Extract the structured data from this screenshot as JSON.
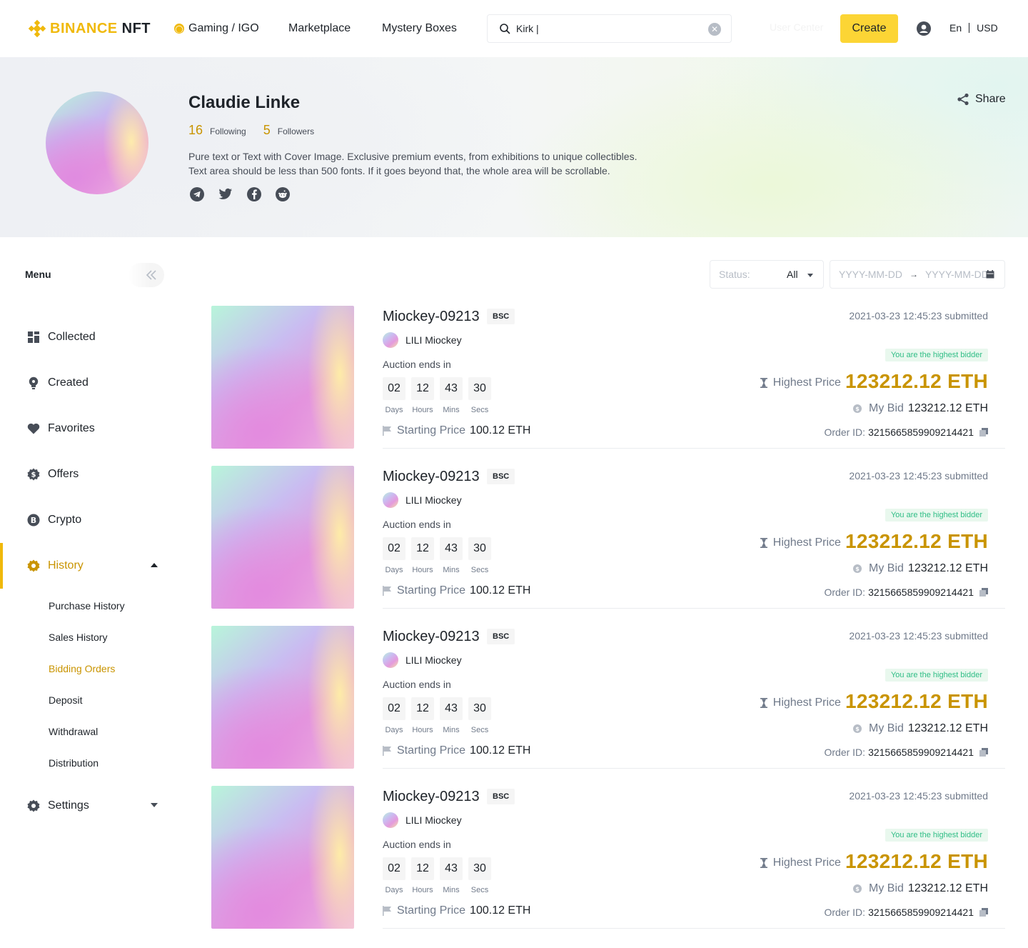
{
  "header": {
    "logo_brand": "BINANCE",
    "logo_product": "NFT",
    "nav": [
      {
        "label": "Gaming / IGO"
      },
      {
        "label": "Marketplace"
      },
      {
        "label": "Mystery Boxes"
      }
    ],
    "search": {
      "value": "Kirk |",
      "icon": "search-icon"
    },
    "user_center_label": "User Center",
    "create_label": "Create",
    "language": "En",
    "currency": "USD"
  },
  "profile": {
    "name": "Claudie Linke",
    "following_count": "16",
    "following_label": "Following",
    "followers_count": "5",
    "followers_label": "Followers",
    "bio_line1": "Pure text or Text with Cover Image. Exclusive premium events, from exhibitions to unique collectibles.",
    "bio_line2": "Text area should be less than 500 fonts. If it goes beyond that, the whole area will be scrollable.",
    "socials": [
      "telegram-icon",
      "twitter-icon",
      "facebook-icon",
      "reddit-icon"
    ],
    "share_label": "Share"
  },
  "sidebar": {
    "title": "Menu",
    "items": [
      {
        "label": "Collected",
        "icon": "grid-icon"
      },
      {
        "label": "Created",
        "icon": "bulb-icon"
      },
      {
        "label": "Favorites",
        "icon": "heart-icon"
      },
      {
        "label": "Offers",
        "icon": "dollar-icon"
      },
      {
        "label": "Crypto",
        "icon": "bitcoin-icon"
      },
      {
        "label": "History",
        "icon": "gear-icon",
        "active": true
      },
      {
        "label": "Settings",
        "icon": "settings-icon"
      }
    ],
    "history_sub": [
      {
        "label": "Purchase History"
      },
      {
        "label": "Sales History"
      },
      {
        "label": "Bidding Orders",
        "active": true
      },
      {
        "label": "Deposit"
      },
      {
        "label": "Withdrawal"
      },
      {
        "label": "Distribution"
      }
    ]
  },
  "filters": {
    "status_label": "Status:",
    "status_value": "All",
    "date_start_placeholder": "YYYY-MM-DD",
    "date_end_placeholder": "YYYY-MM-DD"
  },
  "orders": [
    {
      "title": "Miockey-09213",
      "chain": "BSC",
      "creator": "LILI Miockey",
      "auction_label": "Auction ends in",
      "countdown": [
        {
          "v": "02",
          "u": "Days"
        },
        {
          "v": "12",
          "u": "Hours"
        },
        {
          "v": "43",
          "u": "Mins"
        },
        {
          "v": "30",
          "u": "Secs"
        }
      ],
      "starting_label": "Starting Price",
      "starting_price": "100.12 ETH",
      "submitted": "2021-03-23 12:45:23 submitted",
      "bidder_badge": "You are the highest bidder",
      "highest_label": "Highest Price",
      "highest_price": "123212.12 ETH",
      "mybid_label": "My Bid",
      "mybid": "123212.12 ETH",
      "order_label": "Order ID:",
      "order_id": "3215665859909214421"
    },
    {
      "title": "Miockey-09213",
      "chain": "BSC",
      "creator": "LILI Miockey",
      "auction_label": "Auction ends in",
      "countdown": [
        {
          "v": "02",
          "u": "Days"
        },
        {
          "v": "12",
          "u": "Hours"
        },
        {
          "v": "43",
          "u": "Mins"
        },
        {
          "v": "30",
          "u": "Secs"
        }
      ],
      "starting_label": "Starting Price",
      "starting_price": "100.12 ETH",
      "submitted": "2021-03-23 12:45:23 submitted",
      "bidder_badge": "You are the highest bidder",
      "highest_label": "Highest Price",
      "highest_price": "123212.12 ETH",
      "mybid_label": "My Bid",
      "mybid": "123212.12 ETH",
      "order_label": "Order ID:",
      "order_id": "3215665859909214421"
    },
    {
      "title": "Miockey-09213",
      "chain": "BSC",
      "creator": "LILI Miockey",
      "auction_label": "Auction ends in",
      "countdown": [
        {
          "v": "02",
          "u": "Days"
        },
        {
          "v": "12",
          "u": "Hours"
        },
        {
          "v": "43",
          "u": "Mins"
        },
        {
          "v": "30",
          "u": "Secs"
        }
      ],
      "starting_label": "Starting Price",
      "starting_price": "100.12 ETH",
      "submitted": "2021-03-23 12:45:23 submitted",
      "bidder_badge": "You are the highest bidder",
      "highest_label": "Highest Price",
      "highest_price": "123212.12 ETH",
      "mybid_label": "My Bid",
      "mybid": "123212.12 ETH",
      "order_label": "Order ID:",
      "order_id": "3215665859909214421"
    },
    {
      "title": "Miockey-09213",
      "chain": "BSC",
      "creator": "LILI Miockey",
      "auction_label": "Auction ends in",
      "countdown": [
        {
          "v": "02",
          "u": "Days"
        },
        {
          "v": "12",
          "u": "Hours"
        },
        {
          "v": "43",
          "u": "Mins"
        },
        {
          "v": "30",
          "u": "Secs"
        }
      ],
      "starting_label": "Starting Price",
      "starting_price": "100.12 ETH",
      "submitted": "2021-03-23 12:45:23 submitted",
      "bidder_badge": "You are the highest bidder",
      "highest_label": "Highest Price",
      "highest_price": "123212.12 ETH",
      "mybid_label": "My Bid",
      "mybid": "123212.12 ETH",
      "order_label": "Order ID:",
      "order_id": "3215665859909214421"
    }
  ],
  "colors": {
    "brand": "#F0B90B",
    "accent_text": "#C99400",
    "create_button": "#FCD535",
    "success": "#2EBD85"
  }
}
